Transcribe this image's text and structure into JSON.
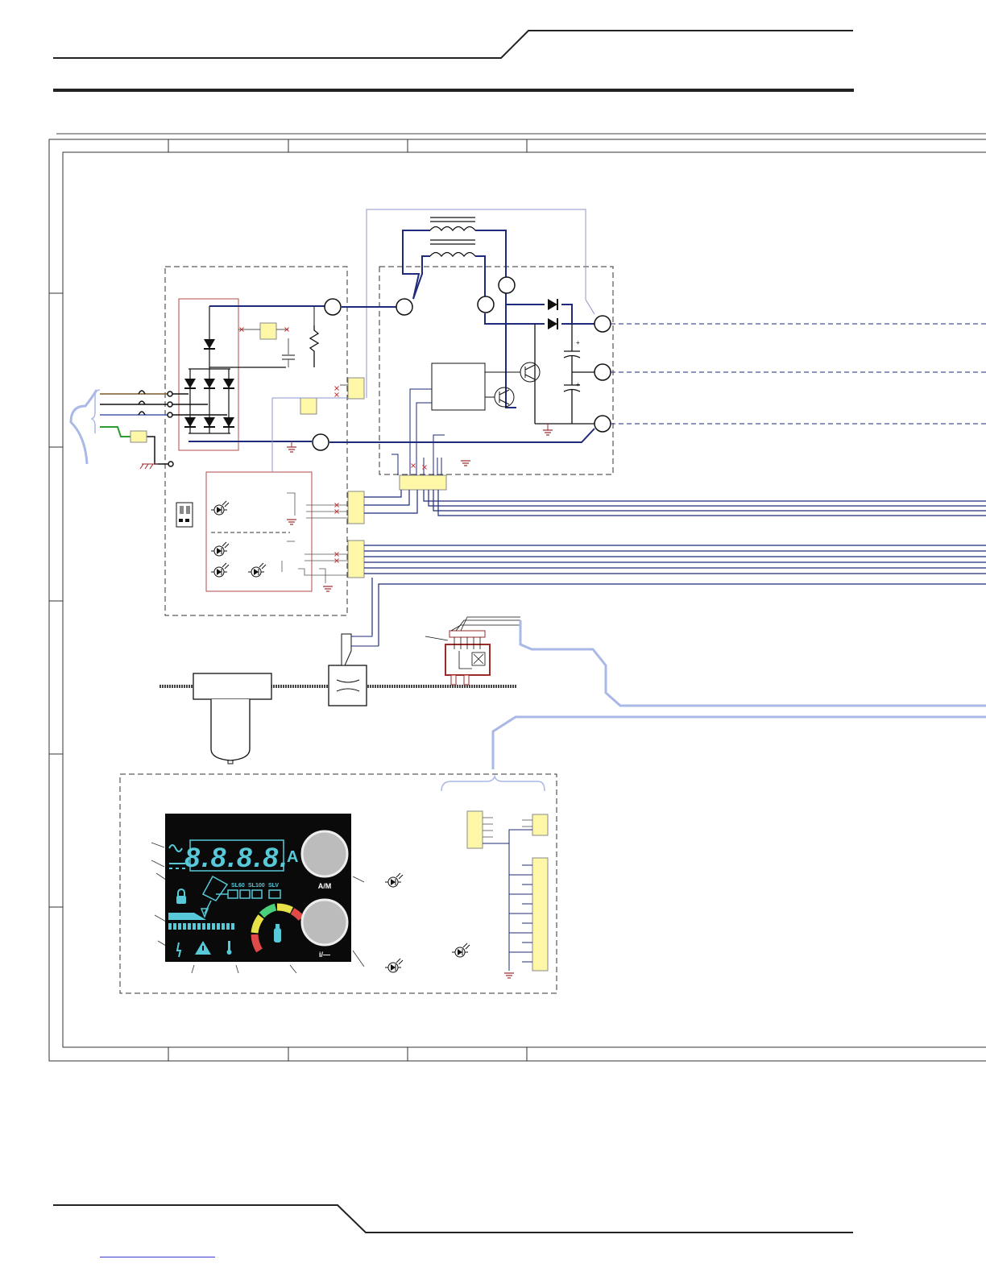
{
  "panel": {
    "digits": "8.8.8.8.",
    "unit": "A",
    "sl_labels": [
      "SL60",
      "SL100",
      "SLV"
    ],
    "knob_top_label": "A/M",
    "knob_bottom_label": "i/—"
  },
  "colors": {
    "wire_main": "#1e2a7a",
    "wire_light": "#8e94c8",
    "cable_bundle": "#a9b8e6",
    "connector_fill": "#fff7a8",
    "pcb_outline": "#b04a4a",
    "lcd_bg": "#0a0a0a",
    "lcd_cyan": "#57c9d8",
    "ground": "#9c2b2b"
  },
  "icons": [
    "lock-icon",
    "gas-cylinder-icon",
    "thermometer-icon",
    "warning-icon",
    "lightning-icon",
    "sine-wave-icon",
    "dc-icon",
    "led-icon",
    "transformer-icon",
    "diode-icon",
    "capacitor-icon",
    "igbt-icon",
    "ground-icon",
    "resistor-icon"
  ]
}
